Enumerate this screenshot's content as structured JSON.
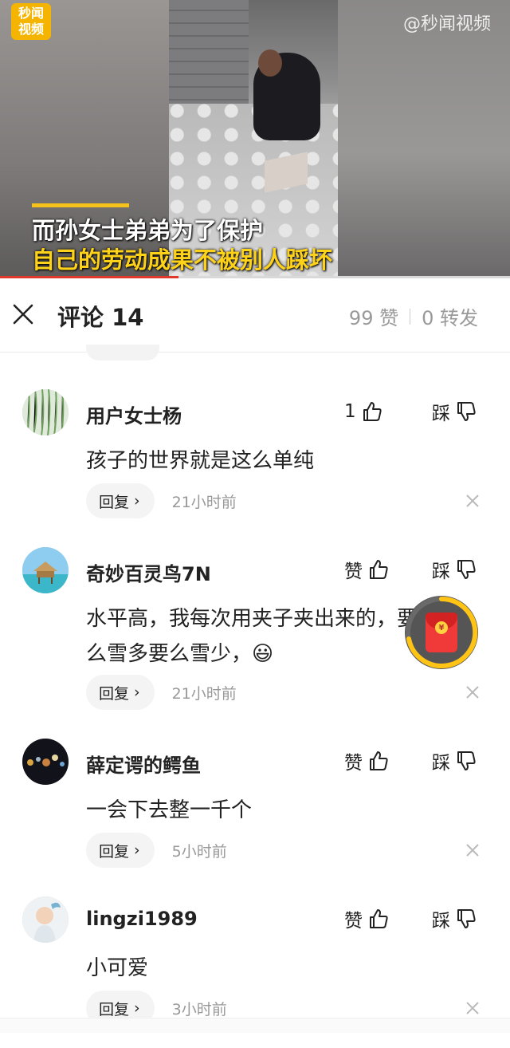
{
  "video": {
    "brand_logo_lines": [
      "秒闻",
      "视频"
    ],
    "watermark": "@秒闻视频",
    "caption_line1": "而孙女士弟弟为了保护",
    "caption_line2": "自己的劳动成果不被别人踩坏",
    "progress": 0.35
  },
  "header": {
    "title": "评论 14",
    "likes": "99 赞",
    "shares": "0 转发"
  },
  "comments": [
    {
      "username": "用户女士杨",
      "like_label": "1",
      "dislike_label": "踩",
      "text": "孩子的世界就是这么单纯",
      "reply_label": "回复",
      "time": "21小时前",
      "avatar": "willow-tree-avatar"
    },
    {
      "username": "奇妙百灵鸟7N",
      "like_label": "赞",
      "dislike_label": "踩",
      "text": "水平高，我每次用夹子夹出来的，要么雪多要么雪少，😃",
      "reply_label": "回复",
      "time": "21小时前",
      "avatar": "beach-hut-avatar"
    },
    {
      "username": "薛定谔的鳄鱼",
      "like_label": "赞",
      "dislike_label": "踩",
      "text": "一会下去整一千个",
      "reply_label": "回复",
      "time": "5小时前",
      "avatar": "planets-avatar"
    },
    {
      "username": "lingzi1989",
      "like_label": "赞",
      "dislike_label": "踩",
      "text": "小可爱",
      "reply_label": "回复",
      "time": "3小时前",
      "avatar": "baby-avatar"
    }
  ],
  "red_packet": {
    "icon": "red-envelope-icon",
    "symbol": "¥"
  },
  "colors": {
    "accent_yellow": "#ffd21a",
    "progress_red": "#e0392b",
    "packet_red": "#f03a3a"
  }
}
